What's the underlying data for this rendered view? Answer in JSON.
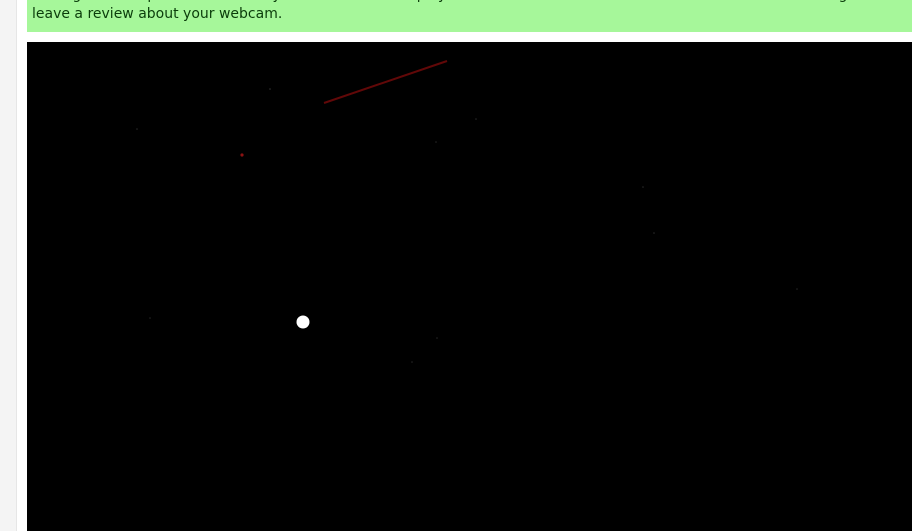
{
  "banner": {
    "message": "Testing was completed successfully. The results are displayed in the \"Webcam information\" table. Please do not forget to leave a review about your webcam.",
    "background_color": "#a6f79a",
    "text_color": "#0b3d0b"
  },
  "video": {
    "background_color": "#000000",
    "content": "webcam-live-feed"
  }
}
